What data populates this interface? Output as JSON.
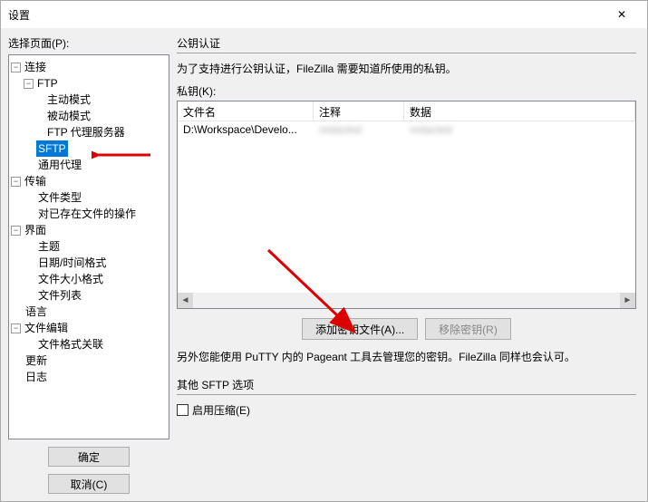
{
  "titlebar": {
    "title": "设置"
  },
  "left": {
    "select_page_label": "选择页面(P):",
    "tree": {
      "connection": "连接",
      "ftp": "FTP",
      "ftp_active": "主动模式",
      "ftp_passive": "被动模式",
      "ftp_proxy": "FTP 代理服务器",
      "sftp": "SFTP",
      "generic_proxy": "通用代理",
      "transfer": "传输",
      "file_types": "文件类型",
      "existing_action": "对已存在文件的操作",
      "interface": "界面",
      "themes": "主题",
      "date_time": "日期/时间格式",
      "size_format": "文件大小格式",
      "file_lists": "文件列表",
      "language": "语言",
      "file_editing": "文件编辑",
      "filetype_assoc": "文件格式关联",
      "updates": "更新",
      "logging": "日志"
    },
    "ok": "确定",
    "cancel": "取消(C)"
  },
  "right": {
    "group_auth": "公钥认证",
    "desc": "为了支持进行公钥认证，FileZilla 需要知道所使用的私钥。",
    "keys_label": "私钥(K):",
    "columns": {
      "file": "文件名",
      "comment": "注释",
      "data": "数据"
    },
    "rows": [
      {
        "file": "D:\\Workspace\\Develo...",
        "comment": "redacted",
        "data": "redacted"
      }
    ],
    "add_key": "添加密钥文件(A)...",
    "remove_key": "移除密钥(R)",
    "note": "另外您能使用 PuTTY 内的 Pageant 工具去管理您的密钥。FileZilla 同样也会认可。",
    "group_other": "其他 SFTP 选项",
    "compression": "启用压缩(E)"
  }
}
